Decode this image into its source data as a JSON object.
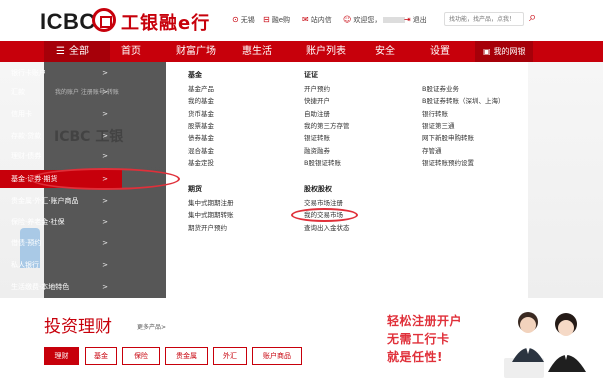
{
  "header": {
    "logo_text": "ICBC",
    "logo_cn": "工银融e行",
    "links": [
      {
        "label": "无锡",
        "icon": "location-icon"
      },
      {
        "label": "融e购",
        "icon": "cart-icon"
      },
      {
        "label": "站内信",
        "icon": "mail-icon"
      },
      {
        "label": "欢迎您，",
        "icon": "user-icon"
      },
      {
        "label": "退出",
        "icon": "logout-icon"
      }
    ],
    "search_placeholder": "找功能，找产品，点我！"
  },
  "nav": {
    "all_label": "全部",
    "items": [
      "首页",
      "财富广场",
      "惠生活",
      "账户列表",
      "安全",
      "设置"
    ],
    "mybank_label": "我的网银"
  },
  "left_menu": [
    {
      "label": "银行卡账户",
      "active": false
    },
    {
      "label": "汇款",
      "active": false
    },
    {
      "label": "信用卡",
      "active": false
    },
    {
      "label": "存款·贷款",
      "active": false
    },
    {
      "label": "理财·债券",
      "active": false
    },
    {
      "label": "基金·证券·期货",
      "active": true
    },
    {
      "label": "贵金属·外汇·账户商品",
      "active": false
    },
    {
      "label": "保险·养老金·社保",
      "active": false
    },
    {
      "label": "借债·预约",
      "active": false
    },
    {
      "label": "私人银行",
      "active": false
    },
    {
      "label": "生活缴费·本地特色",
      "active": false
    }
  ],
  "ghost_text": "我的账户 注册账号 转账",
  "ghost_brand": "工银",
  "panel": {
    "fund": {
      "title": "基金",
      "links": [
        "基金产品",
        "我的基金",
        "货币基金",
        "股票基金",
        "债券基金",
        "混合基金",
        "基金定投"
      ]
    },
    "futures": {
      "title": "期货",
      "links": [
        "集中式期期注册",
        "集中式期期转账",
        "期货开户预约"
      ]
    },
    "securities": {
      "title": "证证",
      "links": [
        "开户预约",
        "快捷开户",
        "自助注册",
        "我的第三方存管",
        "银证转账",
        "融资融券",
        "B股银证转账"
      ]
    },
    "stock_rights": {
      "title": "股权股权",
      "links": [
        "交易市场注册",
        "我的交易市场",
        "查询出入金状态"
      ]
    },
    "b_share": {
      "links": [
        "B股证券业务",
        "B股证券转账（深圳、上海）",
        "银行转账",
        "银证第三通",
        "网下新股申购转账",
        "存管通",
        "银证转账预约设置"
      ]
    }
  },
  "invest": {
    "title": "投资理财",
    "more_label": "更多产品>",
    "tabs": [
      "理财",
      "基金",
      "保险",
      "贵金属",
      "外汇",
      "账户商品"
    ],
    "active_tab": 0
  },
  "promo": {
    "lines": [
      "轻松注册开户",
      "无需工行卡",
      "就是任性!"
    ]
  },
  "colors": {
    "brand_red": "#c7000b",
    "annotation_red": "#e0303a"
  }
}
